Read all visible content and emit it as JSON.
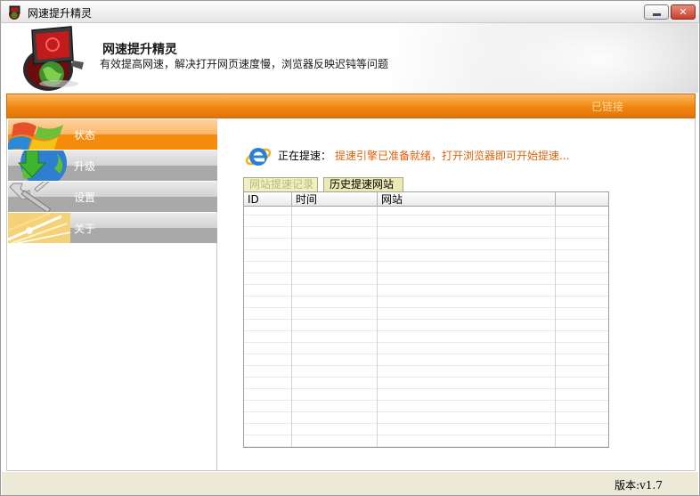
{
  "window": {
    "title": "网速提升精灵",
    "minimize_glyph": "▁",
    "close_glyph": "✕"
  },
  "header": {
    "title": "网速提升精灵",
    "subtitle": "有效提高网速，解决打开网页速度慢，浏览器反映迟钝等问题"
  },
  "status_bar": {
    "right_text": "已链接"
  },
  "sidebar": {
    "items": [
      {
        "label": "状态",
        "icon": "windows-logo-icon",
        "active": true
      },
      {
        "label": "升级",
        "icon": "download-globe-icon",
        "active": false
      },
      {
        "label": "设置",
        "icon": "wrench-tools-icon",
        "active": false
      },
      {
        "label": "关于",
        "icon": "light-burst-icon",
        "active": false
      }
    ]
  },
  "main": {
    "status_label": "正在提速：",
    "status_message": "提速引擎已准备就绪，打开浏览器即可开始提速...",
    "tabs": [
      {
        "label": "网站提速记录",
        "selected": false
      },
      {
        "label": "历史提速网站",
        "selected": true
      }
    ],
    "table": {
      "columns": [
        "ID",
        "时间",
        "网站",
        ""
      ],
      "rows": []
    }
  },
  "footer": {
    "version": "版本:v1.7"
  },
  "colors": {
    "accent_orange": "#f1860f",
    "status_message": "#e0630a",
    "tab_background": "#ece9b6"
  }
}
